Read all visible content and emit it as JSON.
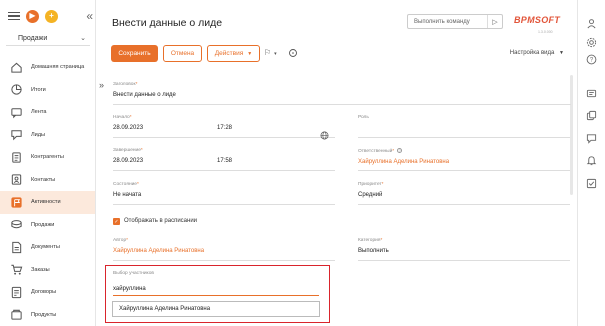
{
  "app": {
    "workspace": "Продажи",
    "logo": "BPMSOFT",
    "version": "1.3.0.000"
  },
  "sidebar": {
    "items": [
      {
        "label": "Домашняя страница",
        "icon": "home-icon",
        "active": false
      },
      {
        "label": "Итоги",
        "icon": "pie-chart-icon",
        "active": false
      },
      {
        "label": "Лента",
        "icon": "feed-icon",
        "active": false
      },
      {
        "label": "Лиды",
        "icon": "lead-icon",
        "active": false
      },
      {
        "label": "Контрагенты",
        "icon": "accounts-icon",
        "active": false
      },
      {
        "label": "Контакты",
        "icon": "contacts-icon",
        "active": false
      },
      {
        "label": "Активности",
        "icon": "flag-icon",
        "active": true
      },
      {
        "label": "Продажи",
        "icon": "sales-icon",
        "active": false
      },
      {
        "label": "Документы",
        "icon": "documents-icon",
        "active": false
      },
      {
        "label": "Заказы",
        "icon": "cart-icon",
        "active": false
      },
      {
        "label": "Договоры",
        "icon": "contract-icon",
        "active": false
      },
      {
        "label": "Продукты",
        "icon": "products-icon",
        "active": false
      }
    ]
  },
  "header": {
    "title": "Внести данные о лиде",
    "command_placeholder": "Выполнить команду"
  },
  "toolbar": {
    "save": "Сохранить",
    "cancel": "Отмена",
    "actions": "Действия",
    "view_settings": "Настройка вида"
  },
  "form": {
    "subject": {
      "label": "Заголовок",
      "value": "Внести данные о лиде"
    },
    "start": {
      "label": "Начало",
      "date": "28.09.2023",
      "time": "17:28"
    },
    "role": {
      "label": "Роль",
      "value": ""
    },
    "end": {
      "label": "Завершение",
      "date": "28.09.2023",
      "time": "17:58"
    },
    "owner": {
      "label": "Ответственный",
      "value": "Хайруллина Аделина Ринатовна"
    },
    "status": {
      "label": "Состояние",
      "value": "Не начата"
    },
    "priority": {
      "label": "Приоритет",
      "value": "Средний"
    },
    "show_in_schedule": {
      "label": "Отображать в расписании",
      "checked": true
    },
    "author": {
      "label": "Автор",
      "value": "Хайруллина Аделина Ринатовна"
    },
    "category": {
      "label": "Категория",
      "value": "Выполнить"
    },
    "participants": {
      "label": "Выбор участников",
      "input_value": "хайруллина",
      "suggestion": "Хайруллина Аделина Ринатовна"
    }
  },
  "colors": {
    "accent": "#e8702a",
    "highlight_border": "#d9242c",
    "active_nav_bg": "#fce9dc"
  }
}
